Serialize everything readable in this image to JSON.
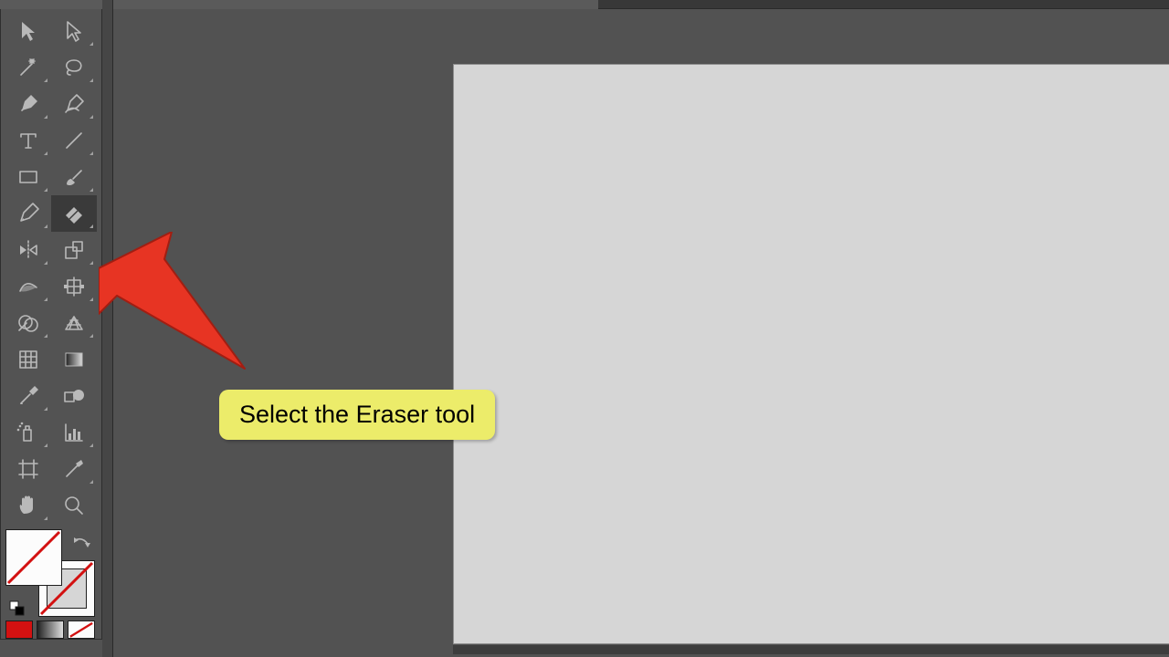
{
  "annotation": {
    "callout_text": "Select the Eraser tool"
  },
  "tools": {
    "selection": "Selection Tool",
    "direct_selection": "Direct Selection Tool",
    "magic_wand": "Magic Wand Tool",
    "lasso": "Lasso Tool",
    "pen": "Pen Tool",
    "curvature": "Curvature Tool",
    "type": "Type Tool",
    "line": "Line Segment Tool",
    "rectangle": "Rectangle Tool",
    "paintbrush": "Paintbrush Tool",
    "pencil": "Pencil Tool",
    "eraser": "Eraser Tool",
    "reflect": "Reflect Tool",
    "scale": "Scale Tool",
    "width": "Width Tool",
    "free_transform": "Free Transform Tool",
    "shape_builder": "Shape Builder Tool",
    "perspective_grid": "Perspective Grid Tool",
    "mesh": "Mesh Tool",
    "gradient": "Gradient Tool",
    "eyedropper": "Eyedropper Tool",
    "blend": "Blend Tool",
    "symbol_sprayer": "Symbol Sprayer Tool",
    "column_graph": "Column Graph Tool",
    "artboard": "Artboard Tool",
    "slice": "Slice Tool",
    "hand": "Hand Tool",
    "zoom": "Zoom Tool"
  },
  "colors": {
    "fill": "none",
    "stroke": "none",
    "modes": [
      "color",
      "gradient",
      "none"
    ]
  },
  "canvas": {
    "background": "#d6d6d6"
  }
}
